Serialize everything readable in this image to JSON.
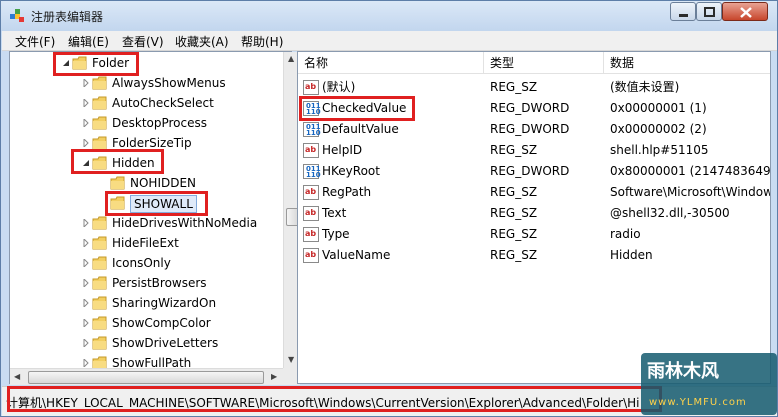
{
  "window": {
    "title": "注册表编辑器",
    "colors": {
      "accent": "#3a6ea5",
      "highlight_box": "#e02020",
      "selection": "#dfeaf9"
    }
  },
  "menubar": {
    "items": [
      "文件(F)",
      "编辑(E)",
      "查看(V)",
      "收藏夹(A)",
      "帮助(H)"
    ]
  },
  "tree": {
    "items": [
      {
        "label": "Folder",
        "expanded": true,
        "icon": "folder-icon"
      },
      {
        "label": "AlwaysShowMenus",
        "icon": "folder-icon"
      },
      {
        "label": "AutoCheckSelect",
        "icon": "folder-icon"
      },
      {
        "label": "DesktopProcess",
        "icon": "folder-icon"
      },
      {
        "label": "FolderSizeTip",
        "icon": "folder-icon"
      },
      {
        "label": "Hidden",
        "expanded": true,
        "icon": "folder-icon"
      },
      {
        "label": "NOHIDDEN",
        "icon": "folder-icon"
      },
      {
        "label": "SHOWALL",
        "selected": true,
        "icon": "folder-open-icon"
      },
      {
        "label": "HideDrivesWithNoMedia",
        "icon": "folder-icon"
      },
      {
        "label": "HideFileExt",
        "icon": "folder-icon"
      },
      {
        "label": "IconsOnly",
        "icon": "folder-icon"
      },
      {
        "label": "PersistBrowsers",
        "icon": "folder-icon"
      },
      {
        "label": "SharingWizardOn",
        "icon": "folder-icon"
      },
      {
        "label": "ShowCompColor",
        "icon": "folder-icon"
      },
      {
        "label": "ShowDriveLetters",
        "icon": "folder-icon"
      },
      {
        "label": "ShowFullPath",
        "icon": "folder-icon"
      }
    ]
  },
  "list": {
    "columns": [
      "名称",
      "类型",
      "数据"
    ],
    "rows": [
      {
        "name": "(默认)",
        "type": "REG_SZ",
        "data": "(数值未设置)",
        "icon": "string-value-icon"
      },
      {
        "name": "CheckedValue",
        "type": "REG_DWORD",
        "data": "0x00000001 (1)",
        "icon": "binary-value-icon"
      },
      {
        "name": "DefaultValue",
        "type": "REG_DWORD",
        "data": "0x00000002 (2)",
        "icon": "binary-value-icon"
      },
      {
        "name": "HelpID",
        "type": "REG_SZ",
        "data": "shell.hlp#51105",
        "icon": "string-value-icon"
      },
      {
        "name": "HKeyRoot",
        "type": "REG_DWORD",
        "data": "0x80000001 (2147483649)",
        "icon": "binary-value-icon"
      },
      {
        "name": "RegPath",
        "type": "REG_SZ",
        "data": "Software\\Microsoft\\Window",
        "icon": "string-value-icon"
      },
      {
        "name": "Text",
        "type": "REG_SZ",
        "data": "@shell32.dll,-30500",
        "icon": "string-value-icon"
      },
      {
        "name": "Type",
        "type": "REG_SZ",
        "data": "radio",
        "icon": "string-value-icon"
      },
      {
        "name": "ValueName",
        "type": "REG_SZ",
        "data": "Hidden",
        "icon": "string-value-icon"
      }
    ]
  },
  "statusbar": {
    "path": "计算机\\HKEY_LOCAL_MACHINE\\SOFTWARE\\Microsoft\\Windows\\CurrentVersion\\Explorer\\Advanced\\Folder\\Hi"
  },
  "watermark": {
    "logo": "雨林木风",
    "url": "www.YLMFU.com"
  }
}
